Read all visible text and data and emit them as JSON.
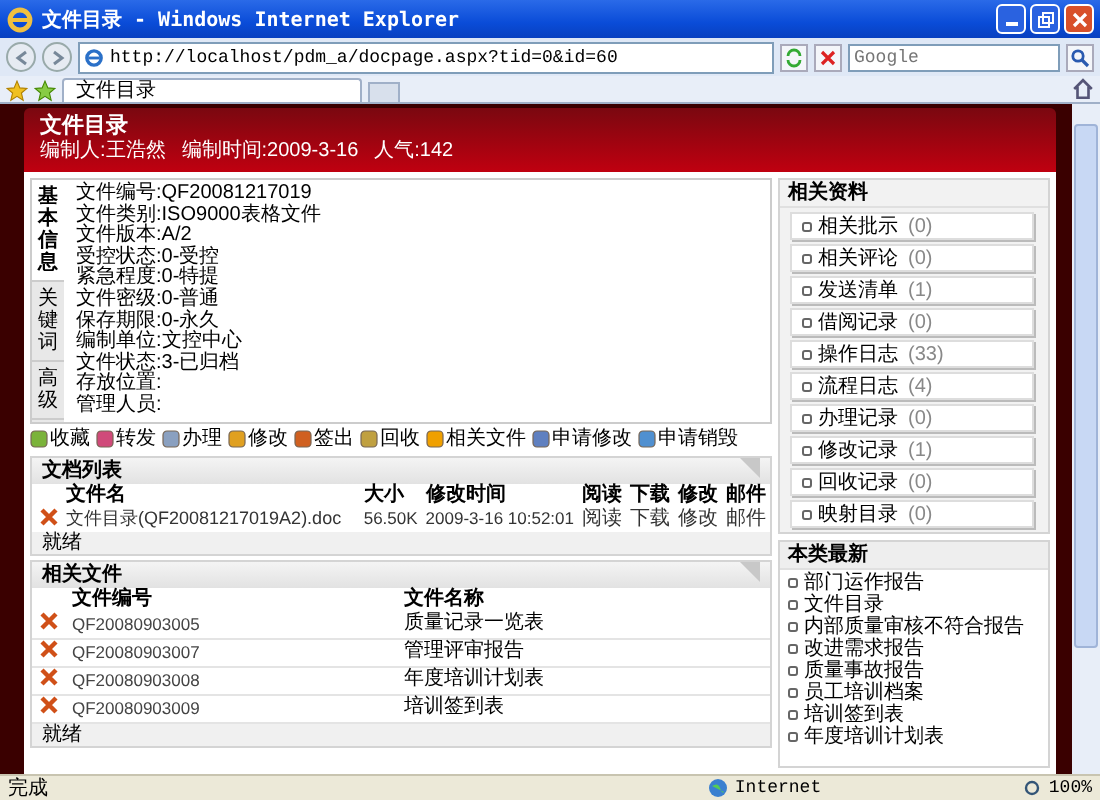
{
  "window": {
    "title": "文件目录 - Windows Internet Explorer"
  },
  "browser": {
    "address": "http://localhost/pdm_a/docpage.aspx?tid=0&id=60",
    "search": {
      "placeholder": "Google"
    },
    "tabs": [
      {
        "label": "文件目录",
        "selected": true
      }
    ]
  },
  "header": {
    "title": "文件目录",
    "meta": [
      "编制人:王浩然",
      "编制时间:2009-3-16",
      "人气:142"
    ]
  },
  "info": {
    "tabs": [
      {
        "label": "基本信息",
        "selected": true
      },
      {
        "label": "关键词",
        "selected": false
      },
      {
        "label": "高级",
        "selected": false
      }
    ],
    "fields": [
      "文件编号:QF20081217019",
      "文件类别:ISO9000表格文件",
      "文件版本:A/2",
      "受控状态:0-受控",
      "紧急程度:0-特提",
      "文件密级:0-普通",
      "保存期限:0-永久",
      "编制单位:文控中心",
      "文件状态:3-已归档",
      "存放位置:",
      "管理人员:"
    ]
  },
  "toolbar": [
    {
      "label": "收藏"
    },
    {
      "label": "转发"
    },
    {
      "label": "办理"
    },
    {
      "label": "修改"
    },
    {
      "label": "签出"
    },
    {
      "label": "回收"
    },
    {
      "label": "相关文件"
    },
    {
      "label": "申请修改"
    },
    {
      "label": "申请销毁"
    }
  ],
  "doc_list": {
    "title": "文档列表",
    "columns": [
      "文件名",
      "大小",
      "修改时间",
      "阅读",
      "下载",
      "修改",
      "邮件"
    ],
    "rows": [
      {
        "cells": [
          "文件目录(QF20081217019A2).doc",
          "56.50K",
          "2009-3-16 10:52:01",
          "阅读",
          "下载",
          "修改",
          "邮件"
        ]
      }
    ],
    "footer": "就绪"
  },
  "related_files": {
    "title": "相关文件",
    "columns": [
      "文件编号",
      "文件名称"
    ],
    "rows": [
      {
        "number": "QF20080903005",
        "name": "质量记录一览表"
      },
      {
        "number": "QF20080903007",
        "name": "管理评审报告"
      },
      {
        "number": "QF20080903008",
        "name": "年度培训计划表"
      },
      {
        "number": "QF20080903009",
        "name": "培训签到表"
      }
    ],
    "footer": "就绪"
  },
  "sidebar": {
    "title": "相关资料",
    "items": [
      {
        "label": "相关批示",
        "count": "(0)"
      },
      {
        "label": "相关评论",
        "count": "(0)"
      },
      {
        "label": "发送清单",
        "count": "(1)"
      },
      {
        "label": "借阅记录",
        "count": "(0)"
      },
      {
        "label": "操作日志",
        "count": "(33)"
      },
      {
        "label": "流程日志",
        "count": "(4)"
      },
      {
        "label": "办理记录",
        "count": "(0)"
      },
      {
        "label": "修改记录",
        "count": "(1)"
      },
      {
        "label": "回收记录",
        "count": "(0)"
      },
      {
        "label": "映射目录",
        "count": "(0)"
      }
    ]
  },
  "latest": {
    "title": "本类最新",
    "items": [
      "部门运作报告",
      "文件目录",
      "内部质量审核不符合报告",
      "改进需求报告",
      "质量事故报告",
      "员工培训档案",
      "培训签到表",
      "年度培训计划表"
    ]
  },
  "status_bar": {
    "text": "完成",
    "zone": "Internet",
    "zoom": "100%"
  }
}
